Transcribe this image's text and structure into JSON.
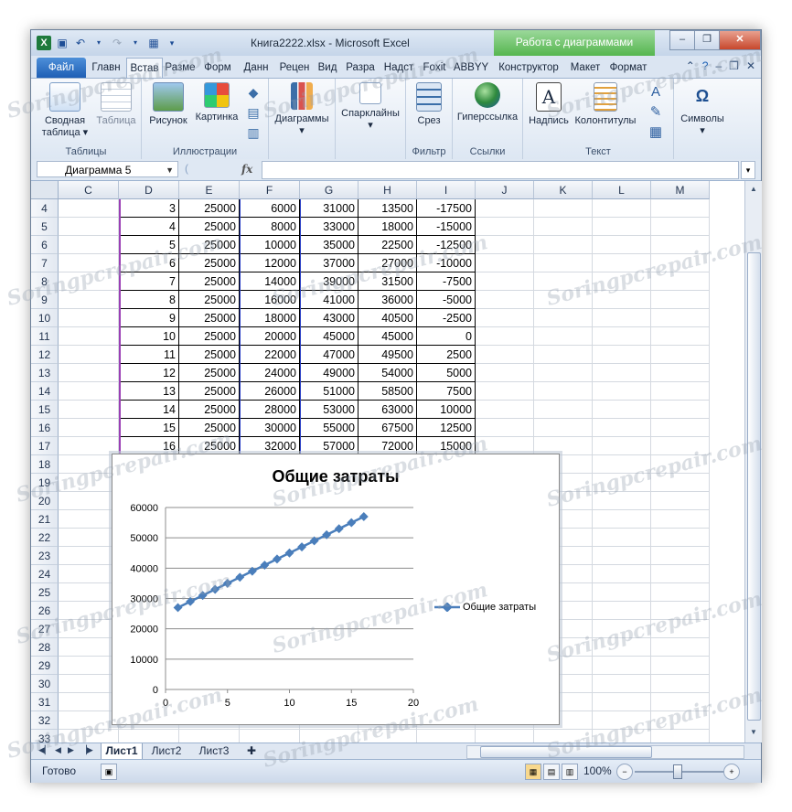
{
  "window": {
    "title": "Книга2222.xlsx  -  Microsoft Excel",
    "context_tab": "Работа с диаграммами"
  },
  "ribbon_tabs": [
    "Файл",
    "Главн",
    "Встав",
    "Разме",
    "Форм",
    "Данн",
    "Рецен",
    "Вид",
    "Разра",
    "Надст",
    "Foxit",
    "ABBYY",
    "Конструктор",
    "Макет",
    "Формат"
  ],
  "ribbon": {
    "groups": {
      "tables": "Таблицы",
      "illustrations": "Иллюстрации",
      "filter": "Фильтр",
      "links": "Ссылки",
      "text": "Текст"
    },
    "buttons": {
      "pivot": "Сводная таблица",
      "table": "Таблица",
      "picture": "Рисунок",
      "clipart": "Картинка",
      "charts": "Диаграммы",
      "sparklines": "Спарклайны",
      "slicer": "Срез",
      "hyperlink": "Гиперссылка",
      "textbox": "Надпись",
      "headerfooter": "Колонтитулы",
      "symbols": "Символы"
    }
  },
  "formula_bar": {
    "name_box": "Диаграмма 5",
    "fx": "fx",
    "formula": ""
  },
  "columns": [
    "C",
    "D",
    "E",
    "F",
    "G",
    "H",
    "I",
    "J",
    "K",
    "L",
    "M"
  ],
  "rows": [
    {
      "n": "4",
      "d": "3",
      "e": "25000",
      "f": "6000",
      "g": "31000",
      "h": "13500",
      "i": "-17500"
    },
    {
      "n": "5",
      "d": "4",
      "e": "25000",
      "f": "8000",
      "g": "33000",
      "h": "18000",
      "i": "-15000"
    },
    {
      "n": "6",
      "d": "5",
      "e": "25000",
      "f": "10000",
      "g": "35000",
      "h": "22500",
      "i": "-12500"
    },
    {
      "n": "7",
      "d": "6",
      "e": "25000",
      "f": "12000",
      "g": "37000",
      "h": "27000",
      "i": "-10000"
    },
    {
      "n": "8",
      "d": "7",
      "e": "25000",
      "f": "14000",
      "g": "39000",
      "h": "31500",
      "i": "-7500"
    },
    {
      "n": "9",
      "d": "8",
      "e": "25000",
      "f": "16000",
      "g": "41000",
      "h": "36000",
      "i": "-5000"
    },
    {
      "n": "10",
      "d": "9",
      "e": "25000",
      "f": "18000",
      "g": "43000",
      "h": "40500",
      "i": "-2500"
    },
    {
      "n": "11",
      "d": "10",
      "e": "25000",
      "f": "20000",
      "g": "45000",
      "h": "45000",
      "i": "0"
    },
    {
      "n": "12",
      "d": "11",
      "e": "25000",
      "f": "22000",
      "g": "47000",
      "h": "49500",
      "i": "2500"
    },
    {
      "n": "13",
      "d": "12",
      "e": "25000",
      "f": "24000",
      "g": "49000",
      "h": "54000",
      "i": "5000"
    },
    {
      "n": "14",
      "d": "13",
      "e": "25000",
      "f": "26000",
      "g": "51000",
      "h": "58500",
      "i": "7500"
    },
    {
      "n": "15",
      "d": "14",
      "e": "25000",
      "f": "28000",
      "g": "53000",
      "h": "63000",
      "i": "10000"
    },
    {
      "n": "16",
      "d": "15",
      "e": "25000",
      "f": "30000",
      "g": "55000",
      "h": "67500",
      "i": "12500"
    },
    {
      "n": "17",
      "d": "16",
      "e": "25000",
      "f": "32000",
      "g": "57000",
      "h": "72000",
      "i": "15000"
    }
  ],
  "empty_rows": [
    "18",
    "19",
    "20",
    "21",
    "22",
    "23",
    "24",
    "25",
    "26",
    "27",
    "28",
    "29",
    "30",
    "31",
    "32",
    "33"
  ],
  "chart_data": {
    "type": "line",
    "title": "Общие затраты",
    "series": [
      {
        "name": "Общие затраты",
        "color": "#4a7ebb",
        "x": [
          1,
          2,
          3,
          4,
          5,
          6,
          7,
          8,
          9,
          10,
          11,
          12,
          13,
          14,
          15,
          16
        ],
        "y": [
          27000,
          29000,
          31000,
          33000,
          35000,
          37000,
          39000,
          41000,
          43000,
          45000,
          47000,
          49000,
          51000,
          53000,
          55000,
          57000
        ]
      }
    ],
    "xlim": [
      0,
      20
    ],
    "ylim": [
      0,
      60000
    ],
    "x_ticks": [
      0,
      5,
      10,
      15,
      20
    ],
    "y_ticks": [
      0,
      10000,
      20000,
      30000,
      40000,
      50000,
      60000
    ],
    "grid": true,
    "legend": "right"
  },
  "sheets": [
    "Лист1",
    "Лист2",
    "Лист3"
  ],
  "status": {
    "ready": "Готово",
    "zoom": "100%"
  },
  "watermark": "Soringpcrepair.com"
}
